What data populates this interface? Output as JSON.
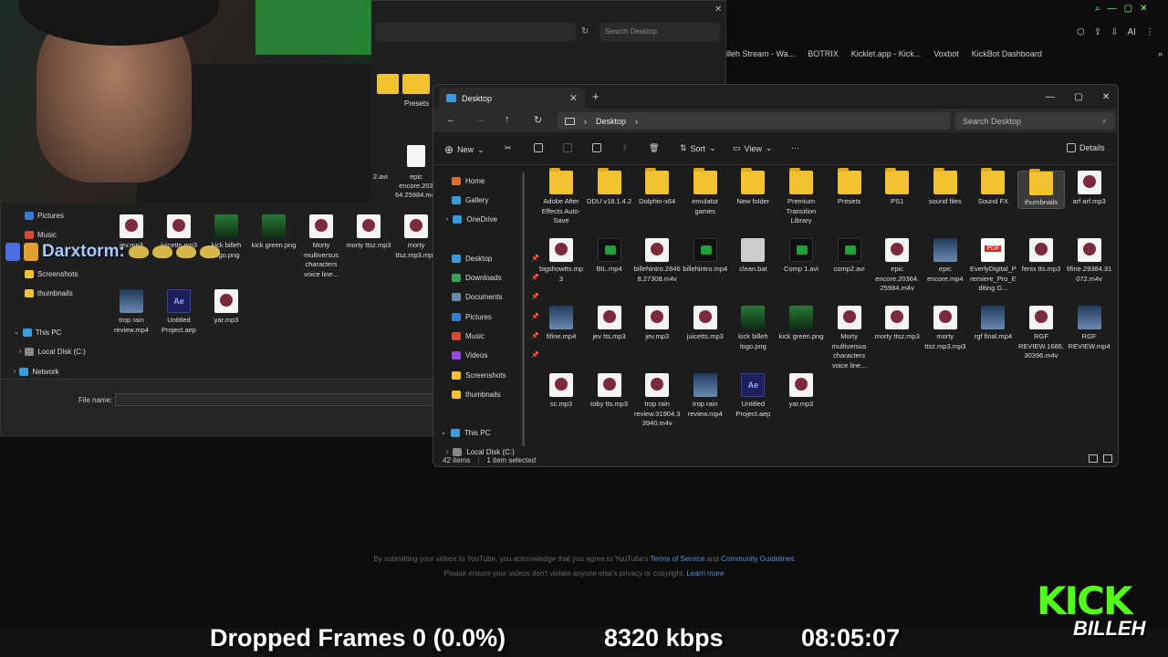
{
  "browser": {
    "bookmarks": [
      "billeh Stream - Wa...",
      "BOTRIX",
      "Kicklet.app - Kick...",
      "Voxbot",
      "KickBot Dashboard"
    ],
    "footer_text1": "By submitting your videos to YouTube, you acknowledge that you agree to YouTube's",
    "footer_link1": "Terms of Service",
    "footer_and": "and",
    "footer_link2": "Community Guidelines",
    "footer_text2": "Please ensure your videos don't violate anyone else's privacy or copyright.",
    "footer_link3": "Learn more",
    "ai_label": "AI"
  },
  "back_dialog": {
    "search_placeholder": "Search Desktop",
    "nav": [
      {
        "label": "Pictures",
        "color": "#3a7bd5"
      },
      {
        "label": "Music",
        "color": "#d94a3a"
      },
      {
        "label": "Screenshots",
        "color": "#f2c230"
      },
      {
        "label": "thumbnails",
        "color": "#f2c230"
      },
      {
        "label": "This PC",
        "color": "#3a9bdc"
      },
      {
        "label": "Local Disk (C:)",
        "color": "#888888"
      },
      {
        "label": "Network",
        "color": "#3a9bdc"
      }
    ],
    "files": [
      {
        "label": "jev.mp3",
        "kind": "media"
      },
      {
        "label": "juicetts.mp3",
        "kind": "media"
      },
      {
        "label": "kick billeh logo.png",
        "kind": "imgpng"
      },
      {
        "label": "kick green.png",
        "kind": "imgpng"
      },
      {
        "label": "Morty multiversus characters voice line...",
        "kind": "media"
      },
      {
        "label": "morty ttsz.mp3",
        "kind": "media"
      },
      {
        "label": "morty ttsz.mp3.mp3",
        "kind": "media"
      },
      {
        "label": "trop rain review.mp4",
        "kind": "vidthumb"
      },
      {
        "label": "Untitled Project.aep",
        "kind": "ae"
      },
      {
        "label": "yar.mp3",
        "kind": "media"
      }
    ],
    "partial_labels": [
      "Presets",
      "epic encore.203 64.25984.m4v",
      "2.avi"
    ],
    "file_name_label": "File name:"
  },
  "chat": {
    "user": "Darxtorm:"
  },
  "explorer": {
    "tab_title": "Desktop",
    "breadcrumb": "Desktop",
    "search_placeholder": "Search Desktop",
    "commands": {
      "new": "New",
      "sort": "Sort",
      "view": "View",
      "more": "···",
      "details": "Details"
    },
    "sidebar": [
      {
        "label": "Home",
        "color": "#e06a3a",
        "pin": false
      },
      {
        "label": "Gallery",
        "color": "#3a9bdc",
        "pin": false
      },
      {
        "label": "OneDrive",
        "color": "#3a9bdc",
        "pin": false
      },
      {
        "label": "Desktop",
        "color": "#3a9bdc",
        "pin": true
      },
      {
        "label": "Downloads",
        "color": "#3aa05a",
        "pin": true
      },
      {
        "label": "Documents",
        "color": "#6a8ab0",
        "pin": true
      },
      {
        "label": "Pictures",
        "color": "#3a7bd5",
        "pin": true
      },
      {
        "label": "Music",
        "color": "#d94a3a",
        "pin": true
      },
      {
        "label": "Videos",
        "color": "#9a4ad9",
        "pin": true
      },
      {
        "label": "Screenshots",
        "color": "#f2c230",
        "pin": false
      },
      {
        "label": "thumbnails",
        "color": "#f2c230",
        "pin": false
      },
      {
        "label": "This PC",
        "color": "#3a9bdc",
        "pin": false
      },
      {
        "label": "Local Disk (C:)",
        "color": "#888888",
        "pin": false
      }
    ],
    "files": [
      {
        "label": "Adobe After Effects Auto-Save",
        "kind": "folder"
      },
      {
        "label": "DDU v18.1.4.2",
        "kind": "folder"
      },
      {
        "label": "Dolphin-x64",
        "kind": "folder"
      },
      {
        "label": "emulator games",
        "kind": "folder"
      },
      {
        "label": "New folder",
        "kind": "folder"
      },
      {
        "label": "Premium Transition Library",
        "kind": "folder"
      },
      {
        "label": "Presets",
        "kind": "folder"
      },
      {
        "label": "PS1",
        "kind": "folder"
      },
      {
        "label": "sound files",
        "kind": "folder"
      },
      {
        "label": "Sound FX",
        "kind": "folder"
      },
      {
        "label": "thumbnails",
        "kind": "folder"
      },
      {
        "label": "arf arf.mp3",
        "kind": "media"
      },
      {
        "label": "bigshowtts.mp3",
        "kind": "media"
      },
      {
        "label": "BIL.mp4",
        "kind": "video"
      },
      {
        "label": "billehintro.28468.27308.m4v",
        "kind": "media"
      },
      {
        "label": "billehintro.mp4",
        "kind": "video"
      },
      {
        "label": "clean.bat",
        "kind": "bat"
      },
      {
        "label": "Comp 1.avi",
        "kind": "video"
      },
      {
        "label": "comp2.avi",
        "kind": "video"
      },
      {
        "label": "epic encore.20364.25984.m4v",
        "kind": "media"
      },
      {
        "label": "epic encore.mp4",
        "kind": "vidthumb"
      },
      {
        "label": "EverlyDigital_Premiere_Pro_Editing G...",
        "kind": "pdf"
      },
      {
        "label": "fenix tts.mp3",
        "kind": "media"
      },
      {
        "label": "fifine.29384.31072.m4v",
        "kind": "media"
      },
      {
        "label": "fifine.mp4",
        "kind": "vidthumb"
      },
      {
        "label": "jev tts.mp3",
        "kind": "media"
      },
      {
        "label": "jev.mp3",
        "kind": "media"
      },
      {
        "label": "juicetts.mp3",
        "kind": "media"
      },
      {
        "label": "kick billeh logo.png",
        "kind": "imgpng"
      },
      {
        "label": "kick green.png",
        "kind": "imgpng"
      },
      {
        "label": "Morty multiversus characters voice line...",
        "kind": "media"
      },
      {
        "label": "morty ttsz.mp3",
        "kind": "media"
      },
      {
        "label": "morty ttsz.mp3.mp3",
        "kind": "media"
      },
      {
        "label": "rgf final.mp4",
        "kind": "vidthumb"
      },
      {
        "label": "RGF REVIEW.1686.30396.m4v",
        "kind": "media"
      },
      {
        "label": "RGF REVIEW.mp4",
        "kind": "vidthumb"
      },
      {
        "label": "sc.mp3",
        "kind": "media"
      },
      {
        "label": "toby tts.mp3",
        "kind": "media"
      },
      {
        "label": "trop rain review.31904.33940.m4v",
        "kind": "media"
      },
      {
        "label": "trop rain review.mp4",
        "kind": "vidthumb"
      },
      {
        "label": "Untitled Project.aep",
        "kind": "ae"
      },
      {
        "label": "yar.mp3",
        "kind": "media"
      }
    ],
    "selected_index": 10,
    "status_items": "42 items",
    "status_selected": "1 item selected"
  },
  "overlay": {
    "dropped_frames": "Dropped Frames 0 (0.0%)",
    "bitrate": "8320 kbps",
    "clock": "08:05:07",
    "kick_logo": "KICK",
    "kick_sub": "BILLEH"
  },
  "colors": {
    "accent_green": "#53fc18",
    "folder": "#f2c230",
    "link": "#5b8bd6"
  }
}
